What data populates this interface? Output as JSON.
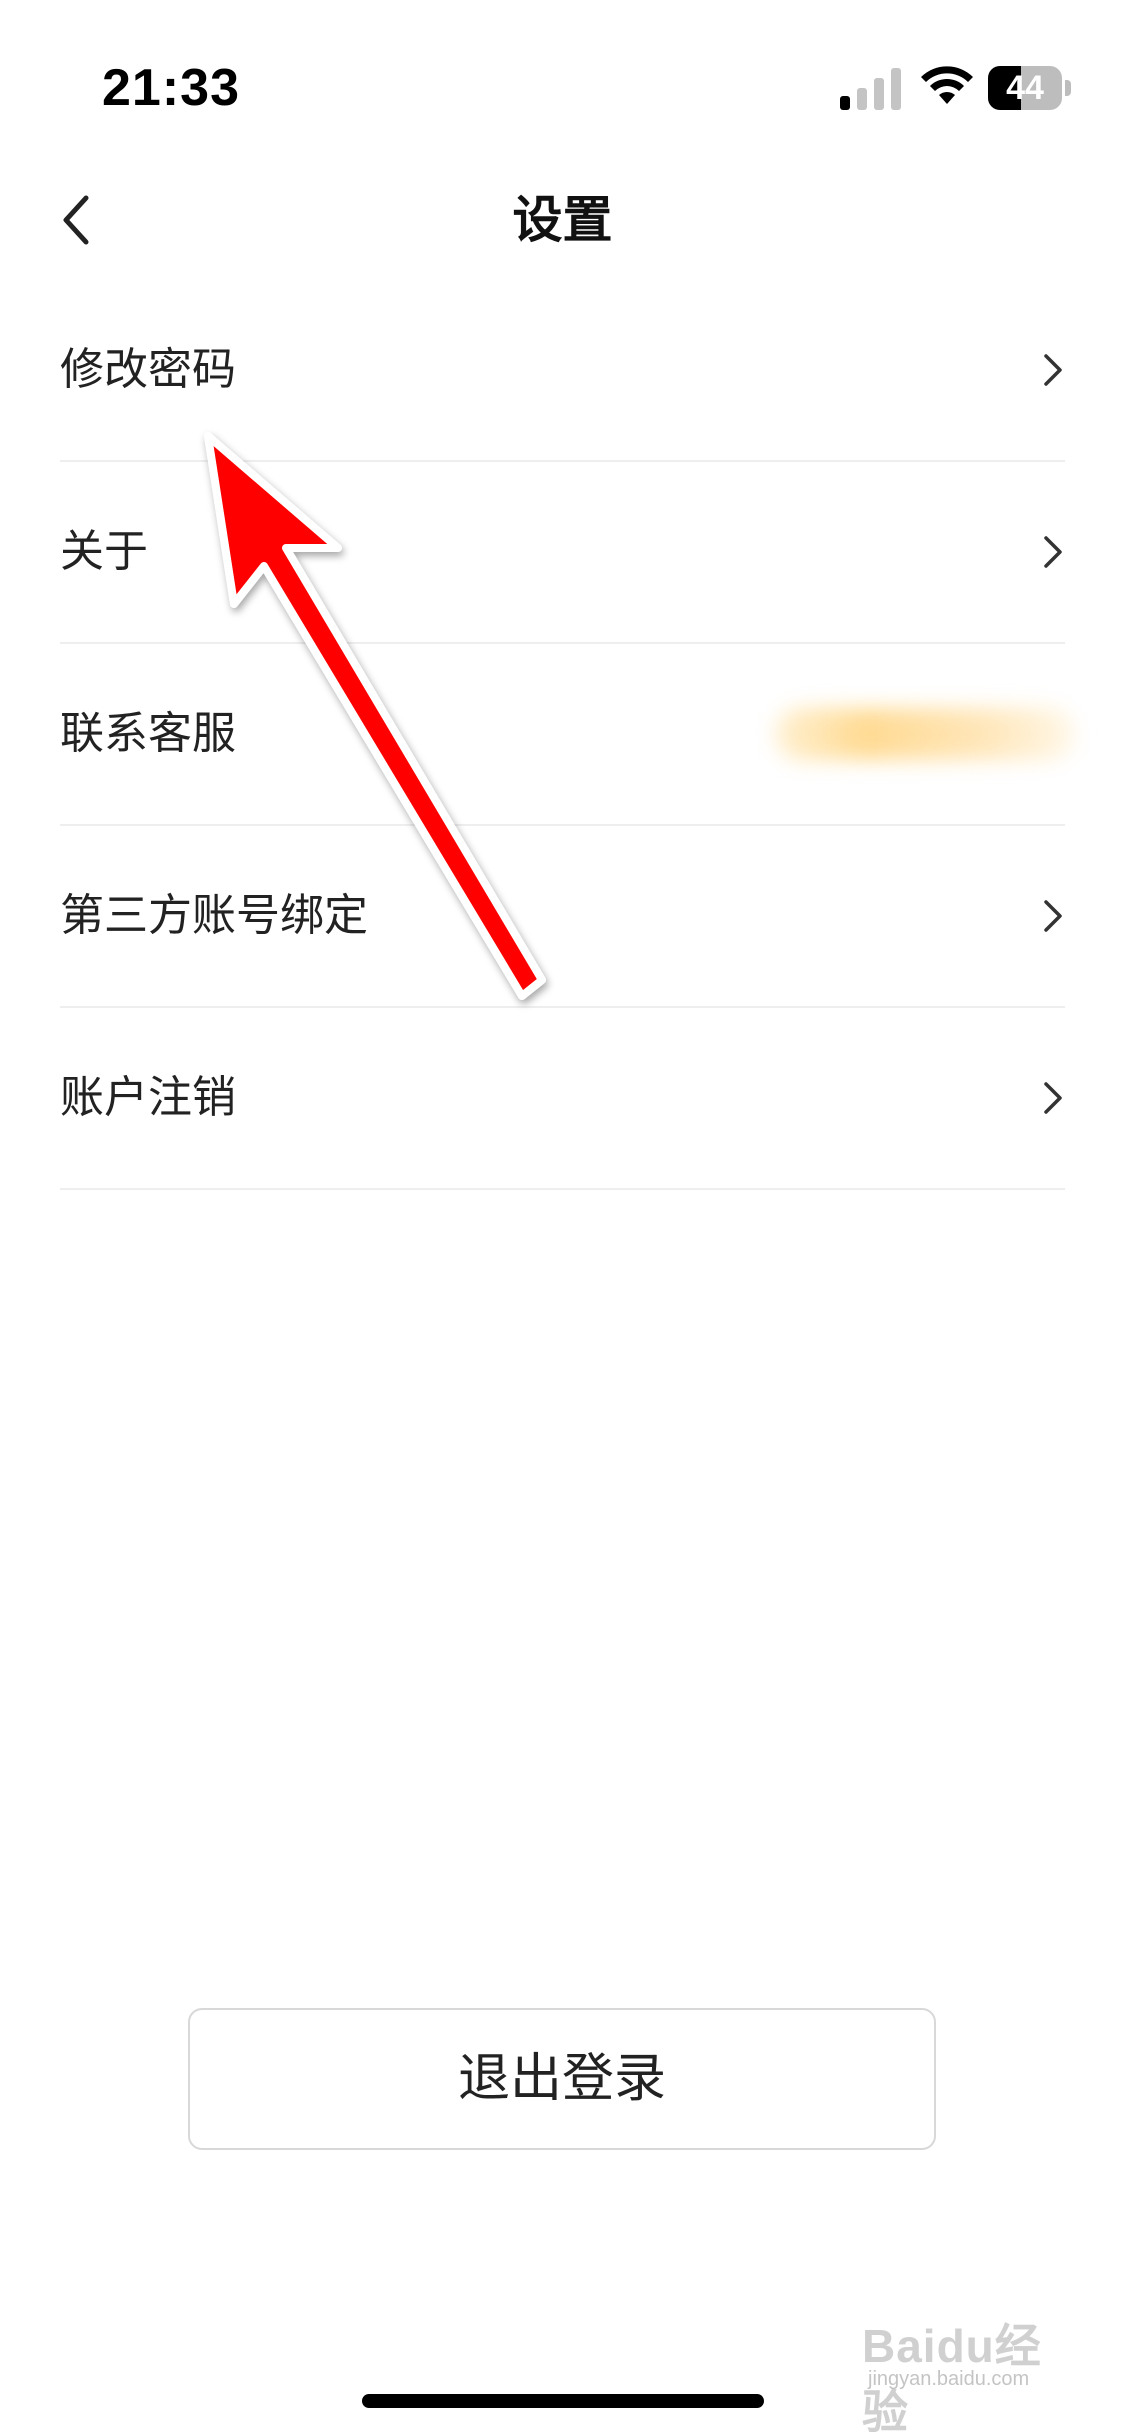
{
  "status_bar": {
    "time": "21:33",
    "signal_icon": "cellular-signal-icon",
    "wifi_icon": "wifi-icon",
    "battery_level": "44",
    "battery_fraction": 0.44
  },
  "nav": {
    "title": "设置",
    "back_icon": "chevron-left-icon"
  },
  "settings": {
    "items": [
      {
        "label": "修改密码",
        "has_chevron": true
      },
      {
        "label": "关于",
        "has_chevron": true
      },
      {
        "label": "联系客服",
        "has_chevron": false,
        "value_blurred": true
      },
      {
        "label": "第三方账号绑定",
        "has_chevron": true
      },
      {
        "label": "账户注销",
        "has_chevron": true
      }
    ]
  },
  "logout": {
    "label": "退出登录"
  },
  "watermark": {
    "brand": "Baidu经验",
    "url": "jingyan.baidu.com"
  },
  "colors": {
    "arrow": "#ff0000",
    "divider": "#eeeeee",
    "text": "#222222",
    "button_border": "#d8d8d8"
  }
}
